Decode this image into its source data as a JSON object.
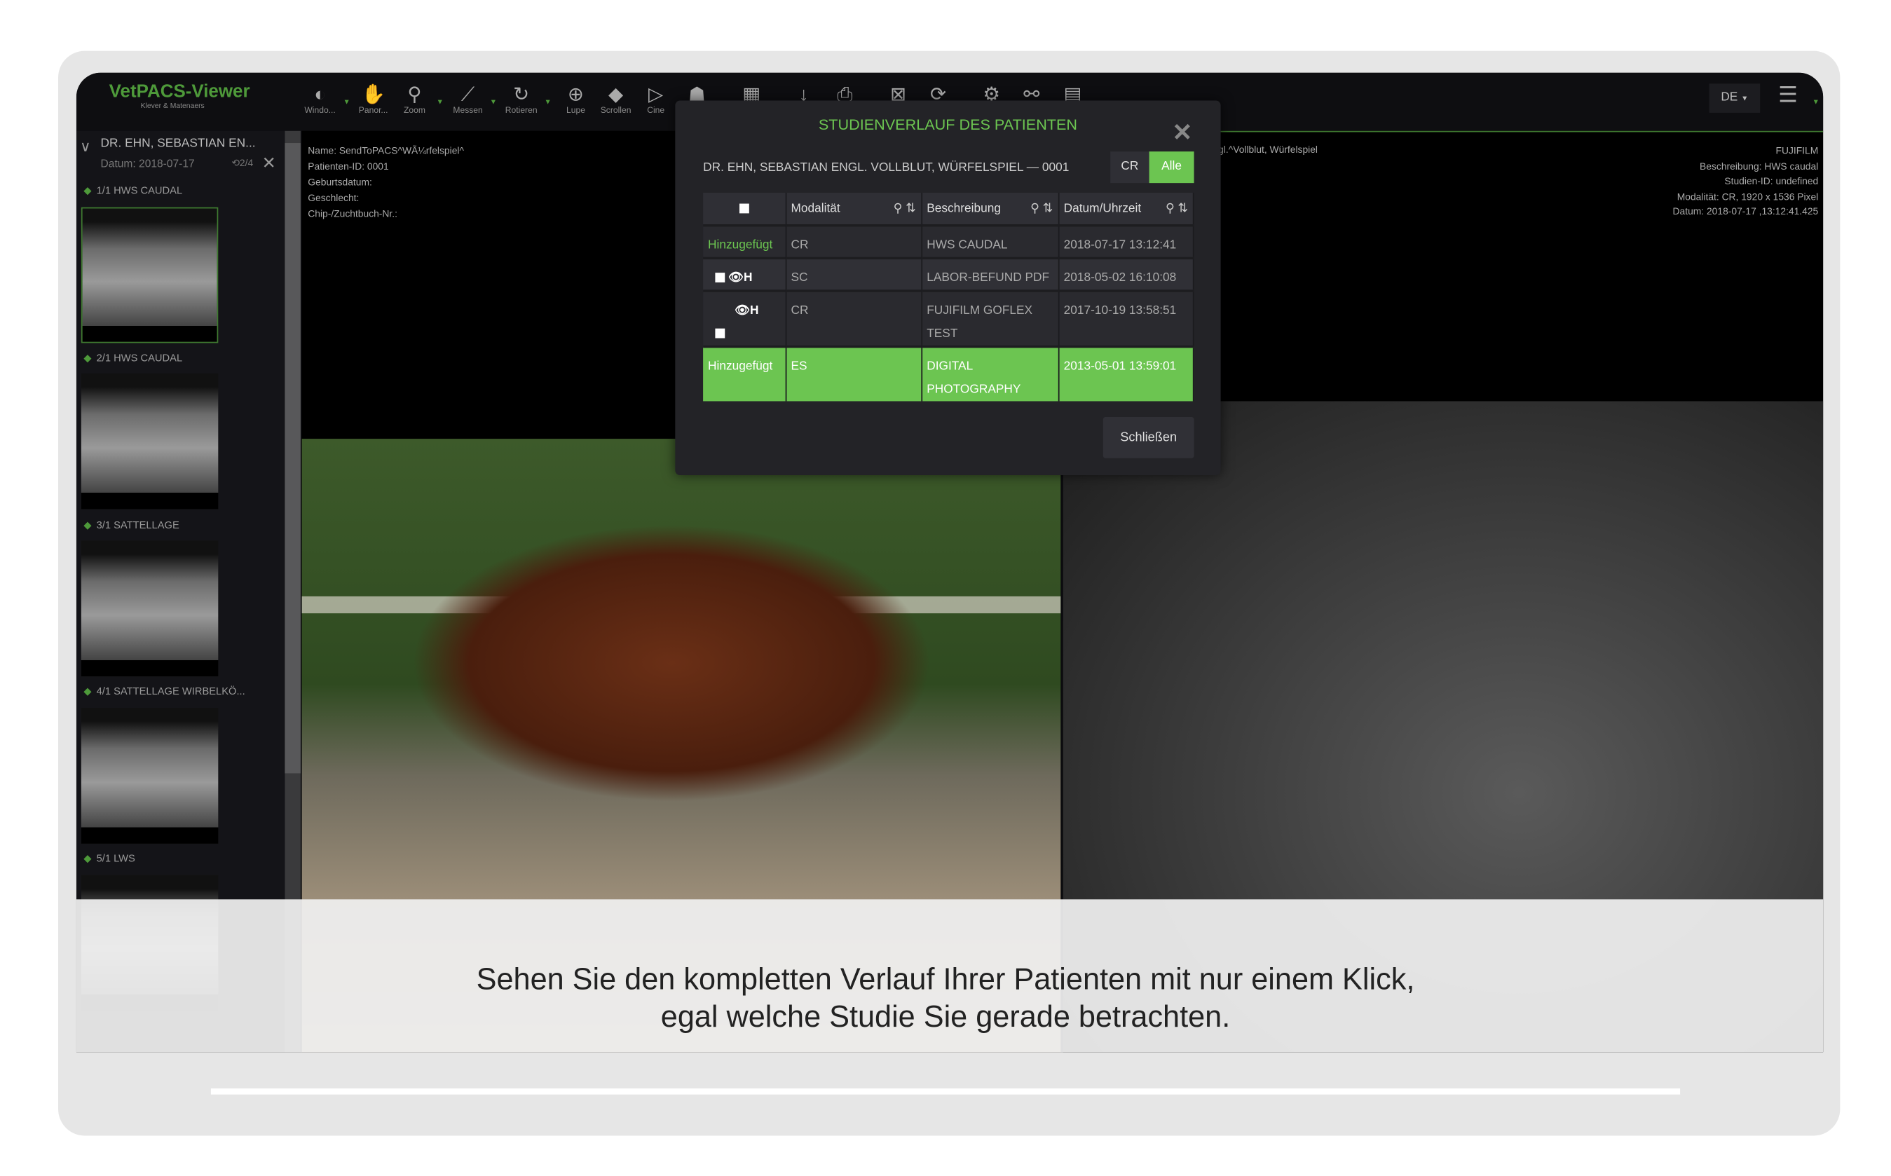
{
  "app": {
    "title": "VetPACS-Viewer",
    "subtitle": "Klever & Matenaers"
  },
  "toolbar": {
    "tools": [
      {
        "icon": "window-level-icon",
        "label": "Windo..."
      },
      {
        "icon": "pan-hand-icon",
        "label": "Panor..."
      },
      {
        "icon": "zoom-icon",
        "label": "Zoom"
      },
      {
        "icon": "measure-icon",
        "label": "Messen"
      },
      {
        "icon": "rotate-icon",
        "label": "Rotieren"
      },
      {
        "icon": "magnifier-icon",
        "label": "Lupe"
      },
      {
        "icon": "layers-icon",
        "label": "Scrollen"
      },
      {
        "icon": "play-icon",
        "label": "Cine"
      }
    ],
    "language": "DE"
  },
  "sidebar": {
    "patient": "DR. EHN, SEBASTIAN EN...",
    "date": "Datum: 2018-07-17",
    "history": "2/4",
    "series": [
      {
        "label": "1/1  HWS CAUDAL"
      },
      {
        "label": "2/1  HWS CAUDAL"
      },
      {
        "label": "3/1  SATTELLAGE"
      },
      {
        "label": "4/1  SATTELLAGE WIRBELKÖ..."
      },
      {
        "label": "5/1  LWS"
      }
    ]
  },
  "viewport1": {
    "info": [
      "Name: SendToPACS^WÃ¼rfelspiel^",
      "Patienten-ID: 0001",
      "Geburtsdatum:",
      "Geschlecht:",
      "Chip-/Zuchtbuch-Nr.:"
    ]
  },
  "viewport2": {
    "info_left": "gl.^Vollblut, Würfelspiel",
    "info_right": [
      "FUJIFILM",
      "Beschreibung: HWS caudal",
      "Studien-ID: undefined",
      "Modalität: CR, 1920 x 1536  Pixel",
      "Datum: 2018-07-17 ,13:12:41.425"
    ]
  },
  "dialog": {
    "title": "STUDIENVERLAUF DES PATIENTEN",
    "patient": "DR. EHN, SEBASTIAN ENGL. VOLLBLUT, WÜRFELSPIEL — 0001",
    "filters": [
      "CR",
      "Alle"
    ],
    "active_filter": "Alle",
    "columns": [
      "Modalität",
      "Beschreibung",
      "Datum/Uhrzeit"
    ],
    "rows": [
      {
        "status": "Hinzugefügt",
        "modality": "CR",
        "description": "HWS CAUDAL",
        "datetime": "2018-07-17 13:12:41"
      },
      {
        "status": "",
        "modality": "SC",
        "description": "LABOR-BEFUND PDF",
        "datetime": "2018-05-02 16:10:08"
      },
      {
        "status": "",
        "modality": "CR",
        "description": "FUJIFILM GOFLEX TEST",
        "datetime": "2017-10-19 13:58:51"
      },
      {
        "status": "Hinzugefügt",
        "modality": "ES",
        "description": "DIGITAL PHOTOGRAPHY",
        "datetime": "2013-05-01 13:59:01",
        "selected": true
      }
    ],
    "close_label": "Schließen"
  },
  "caption": {
    "line1": "Sehen Sie den kompletten Verlauf Ihrer Patienten mit nur einem Klick,",
    "line2": "egal welche Studie Sie gerade betrachten."
  },
  "colors": {
    "accent": "#6cc551",
    "background": "#0c0c0f"
  }
}
